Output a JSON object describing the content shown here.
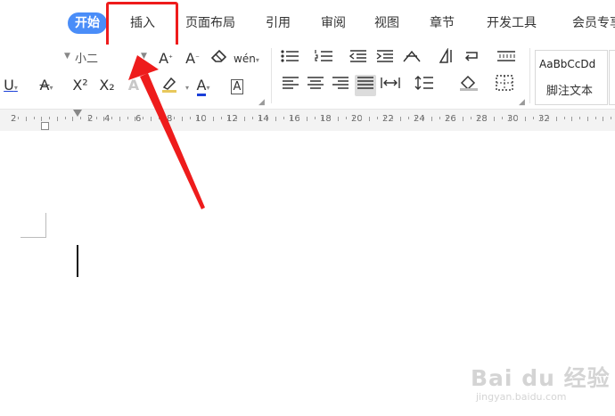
{
  "tabs": [
    {
      "label": "开始",
      "active": true
    },
    {
      "label": "插入",
      "active": false
    },
    {
      "label": "页面布局",
      "active": false
    },
    {
      "label": "引用",
      "active": false
    },
    {
      "label": "审阅",
      "active": false
    },
    {
      "label": "视图",
      "active": false
    },
    {
      "label": "章节",
      "active": false
    },
    {
      "label": "开发工具",
      "active": false
    },
    {
      "label": "会员专享",
      "active": false
    }
  ],
  "toolbar": {
    "font_size": "小二",
    "style_sample": "AaBbCcDd",
    "style_name": "脚注文本",
    "bold_a_gray": "A",
    "box_a": "A",
    "pinyin_label": "wén",
    "superscript_label": "X²",
    "subscript_label": "X₂"
  },
  "ruler": {
    "numbers": [
      "2",
      "2",
      "4",
      "6",
      "8",
      "10",
      "12",
      "14",
      "16",
      "18",
      "20",
      "22",
      "24",
      "26",
      "28",
      "30",
      "32"
    ]
  },
  "watermark": {
    "logo": "Bai du 经验",
    "url": "jingyan.baidu.com"
  },
  "colors": {
    "active_tab": "#4a8df8",
    "highlight": "#ee1c1c",
    "font_color_underline": "#1a3fd8",
    "highlighter": "#e8c85c"
  },
  "icons": [
    "underline-icon",
    "strikethrough-icon",
    "superscript-icon",
    "subscript-icon",
    "text-effect-icon",
    "highlighter-icon",
    "font-color-icon",
    "char-border-icon",
    "grow-font-icon",
    "shrink-font-icon",
    "clear-format-icon",
    "pinyin-icon",
    "bullet-list-icon",
    "numbered-list-icon",
    "decrease-indent-icon",
    "increase-indent-icon",
    "chinese-layout-icon",
    "sort-icon",
    "show-marks-icon",
    "table-lines-icon",
    "align-left-icon",
    "align-center-icon",
    "align-right-icon",
    "justify-icon",
    "distribute-icon",
    "line-spacing-icon",
    "shading-icon",
    "borders-icon"
  ]
}
